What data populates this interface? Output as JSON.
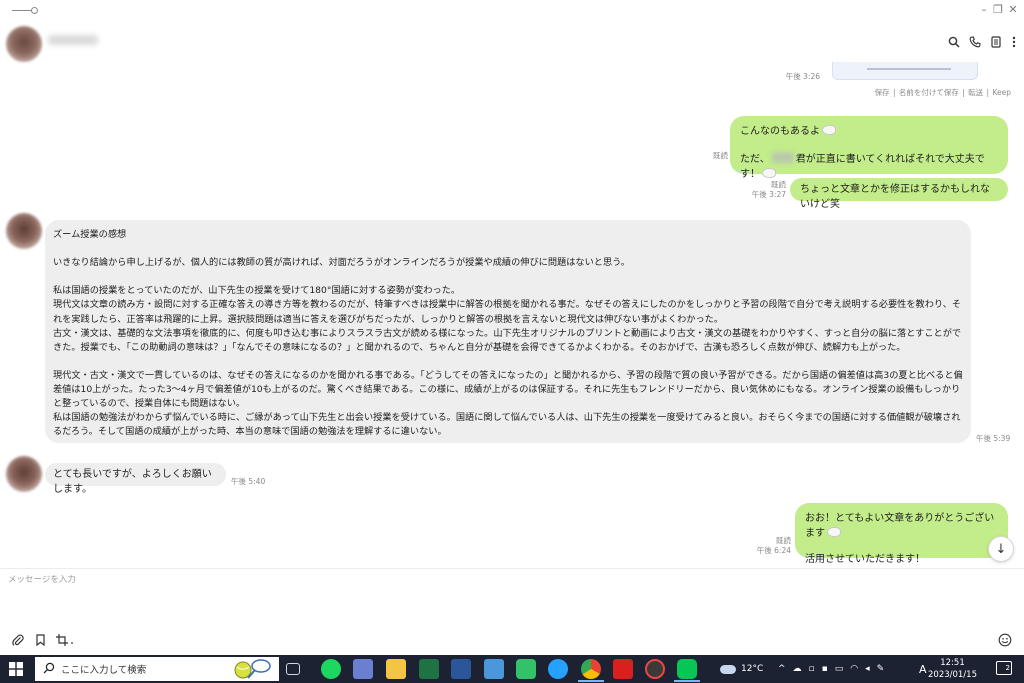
{
  "file_card": {
    "time": "午後 3:26",
    "actions": [
      "保存",
      "名前を付けて保存",
      "転送",
      "Keep"
    ]
  },
  "messages": {
    "m1_line1": "こんなのもあるよ",
    "m1_line2_pre": "ただ、",
    "m1_line2_post": "君が正直に書いてくれればそれで大丈夫です！",
    "m1_read": "既読",
    "m2_text": "ちょっと文章とかを修正はするかもしれないけど笑",
    "m2_read": "既読",
    "m2_time": "午後 3:27",
    "long_msg_paragraphs": [
      "ズーム授業の感想",
      "",
      "いきなり結論から申し上げるが、個人的には教師の質が高ければ、対面だろうがオンラインだろうが授業や成績の伸びに問題はないと思う。",
      "",
      "私は国語の授業をとっていたのだが、山下先生の授業を受けて180°国語に対する姿勢が変わった。",
      "現代文は文章の読み方・設問に対する正確な答えの導き方等を教わるのだが、特筆すべきは授業中に解答の根拠を聞かれる事だ。なぜその答えにしたのかをしっかりと予習の段階で自分で考え説明する必要性を教わり、それを実践したら、正答率は飛躍的に上昇。選択肢問題は適当に答えを選びがちだったが、しっかりと解答の根拠を言えないと現代文は伸びない事がよくわかった。",
      "古文・漢文は、基礎的な文法事項を徹底的に、何度も叩き込む事によりスラスラ古文が読める様になった。山下先生オリジナルのプリントと動画により古文・漢文の基礎をわかりやすく、すっと自分の脳に落とすことができた。授業でも、「この助動詞の意味は？」「なんでその意味になるの？」と聞かれるので、ちゃんと自分が基礎を会得できてるかよくわかる。そのおかげで、古漢も恐ろしく点数が伸び、読解力も上がった。",
      "",
      "現代文・古文・漢文で一貫しているのは、なぜその答えになるのかを聞かれる事である。「どうしてその答えになったの」と聞かれるから、予習の段階で質の良い予習ができる。だから国語の偏差値は高3の夏と比べると偏差値は10上がった。たった3〜4ヶ月で偏差値が10も上がるのだ。驚くべき結果である。この様に、成績が上がるのは保証する。それに先生もフレンドリーだから、良い気休めにもなる。オンライン授業の設備もしっかりと整っているので、授業自体にも問題はない。",
      "私は国語の勉強法がわからず悩んでいる時に、ご縁があって山下先生と出会い授業を受けている。国語に関して悩んでいる人は、山下先生の授業を一度受けてみると良い。おそらく今までの国語に対する価値観が破壊されるだろう。そして国語の成績が上がった時、本当の意味で国語の勉強法を理解するに違いない。"
    ],
    "long_msg_time": "午後 5:39",
    "m3_text": "とても長いですが、よろしくお願いします。",
    "m3_time": "午後 5:40",
    "m4_line1": "おお！とてもよい文章をありがとうございます",
    "m4_line2": "活用させていただきます！",
    "m4_read": "既読",
    "m4_time": "午後 6:24"
  },
  "input": {
    "placeholder": "メッセージを入力"
  },
  "taskbar": {
    "search_placeholder": "ここに入力して検索",
    "weather": "12°C",
    "ime": "A",
    "time": "12:51",
    "date": "2023/01/15",
    "notification_count": "2"
  },
  "colors": {
    "bubble_green": "#c3ec8a",
    "bubble_gray": "#eeeeee",
    "taskbar_bg": "#1c2232"
  },
  "icons": [
    "search-icon",
    "phone-icon",
    "notes-icon",
    "more-icon",
    "paperclip-icon",
    "bookmark-icon",
    "crop-icon",
    "emoji-icon",
    "arrow-down-icon",
    "windows-icon",
    "weather-cloud-icon"
  ]
}
